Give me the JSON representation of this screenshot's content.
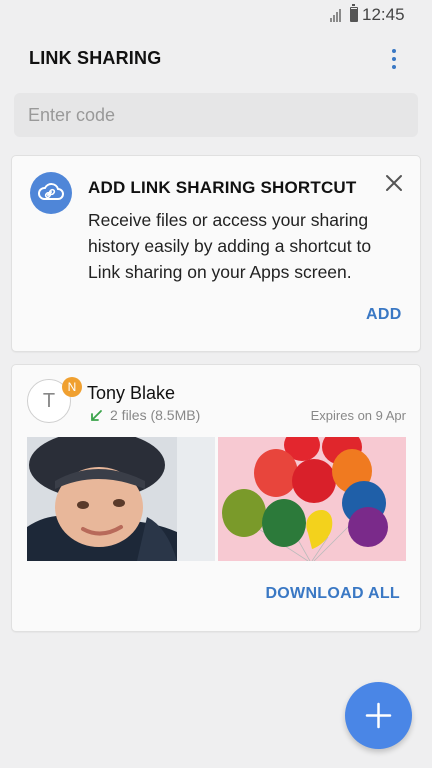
{
  "status_bar": {
    "time": "12:45",
    "signal_icon": "signal-icon",
    "battery_icon": "battery-icon"
  },
  "app_bar": {
    "title": "LINK SHARING",
    "menu_icon": "more-vert-icon"
  },
  "code_input": {
    "placeholder": "Enter code",
    "value": ""
  },
  "shortcut_card": {
    "icon": "cloud-link-icon",
    "title": "ADD LINK SHARING SHORTCUT",
    "body": "Receive files or access your sharing history easily by adding a shortcut to Link sharing on your Apps screen.",
    "close_icon": "close-icon",
    "add_label": "ADD"
  },
  "share_card": {
    "avatar_initial": "T",
    "new_badge": "N",
    "sender": "Tony Blake",
    "files_info": "2 files (8.5MB)",
    "expires": "Expires on 9 Apr",
    "download_all_label": "DOWNLOAD ALL",
    "thumbnails": [
      "boy-photo",
      "balloons-photo"
    ]
  },
  "fab": {
    "icon": "plus-icon"
  },
  "colors": {
    "accent": "#3a78c4",
    "fab": "#4a86e6",
    "badge": "#f0a030",
    "background": "#efeff0"
  }
}
